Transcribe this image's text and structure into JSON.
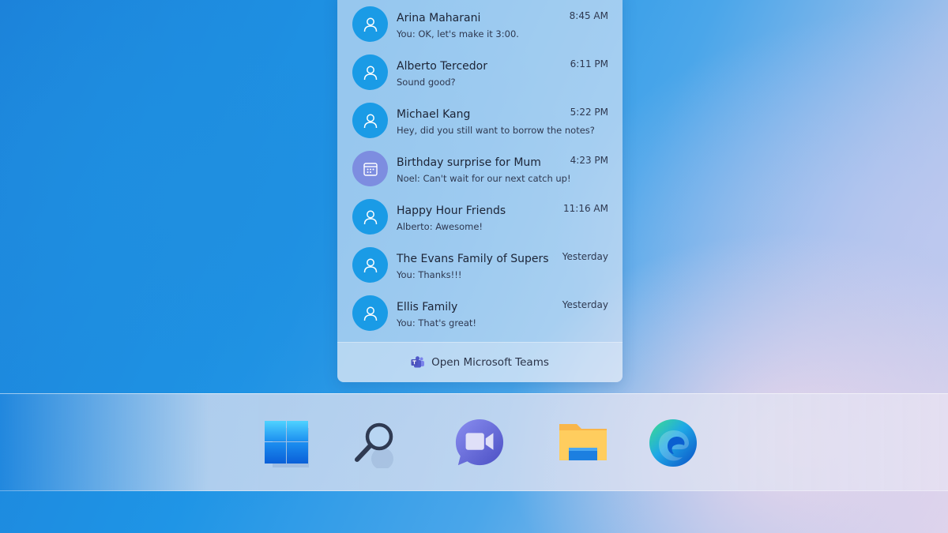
{
  "chats": [
    {
      "name": "Arina Maharani",
      "preview": "You: OK, let's make it 3:00.",
      "time": "8:45 AM",
      "avatar": "person-icon"
    },
    {
      "name": "Alberto Tercedor",
      "preview": "Sound good?",
      "time": "6:11 PM",
      "avatar": "person-icon"
    },
    {
      "name": "Michael Kang",
      "preview": "Hey, did you still want to borrow the notes?",
      "time": "5:22 PM",
      "avatar": "person-icon"
    },
    {
      "name": "Birthday surprise for Mum",
      "preview": "Noel: Can't wait for our next catch up!",
      "time": "4:23 PM",
      "avatar": "calendar-icon"
    },
    {
      "name": "Happy Hour Friends",
      "preview": "Alberto: Awesome!",
      "time": "11:16 AM",
      "avatar": "person-icon"
    },
    {
      "name": "The Evans Family of Supers",
      "preview": "You: Thanks!!!",
      "time": "Yesterday",
      "avatar": "person-icon"
    },
    {
      "name": "Ellis Family",
      "preview": "You: That's great!",
      "time": "Yesterday",
      "avatar": "person-icon"
    }
  ],
  "footer": {
    "label": "Open Microsoft Teams",
    "icon": "teams-icon"
  },
  "taskbar": {
    "items": [
      "start-icon",
      "search-icon",
      "chat-icon",
      "file-explorer-icon",
      "edge-icon"
    ]
  },
  "colors": {
    "avatar_blue": "#1a9be6",
    "avatar_purple": "#7d8de0"
  }
}
